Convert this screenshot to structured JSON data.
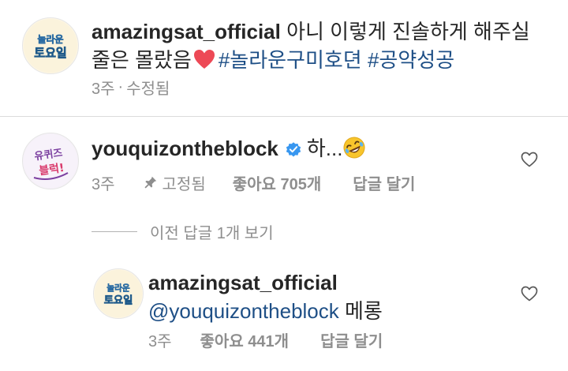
{
  "comment1": {
    "avatar_text_top": "놀라운",
    "avatar_text_bottom": "토요일",
    "username": "amazingsat_official",
    "text_line1": "아니 이렇게 진솔하게 해주실",
    "text_line2": "줄은 몰랐음",
    "emoji": "heart-emoji",
    "hashtag1": "#놀라운구미호뎐",
    "hashtag2": "#공약성공",
    "time": "3주",
    "separator": "·",
    "edited": "수정됨"
  },
  "comment2": {
    "avatar_text_top": "유퀴즈",
    "avatar_text_bottom": "블럭!",
    "username": "youquizontheblock",
    "verified_icon": "verified-badge-icon",
    "text": "하...",
    "emoji": "rolling-laughing-emoji",
    "time": "3주",
    "pinned": "고정됨",
    "likes": "좋아요 705개",
    "reply": "답글 달기",
    "like_icon": "heart-outline-icon"
  },
  "view_replies": "이전 답글 1개 보기",
  "reply1": {
    "avatar_text_top": "놀라운",
    "avatar_text_bottom": "토요일",
    "username": "amazingsat_official",
    "mention": "@youquizontheblock",
    "text": "메롱",
    "time": "3주",
    "likes": "좋아요 441개",
    "reply": "답글 달기",
    "like_icon": "heart-outline-icon"
  },
  "colors": {
    "text": "#262626",
    "meta": "#8e8e8e",
    "link": "#1e4f86",
    "verified": "#3897f0",
    "heart": "#ed4956"
  }
}
